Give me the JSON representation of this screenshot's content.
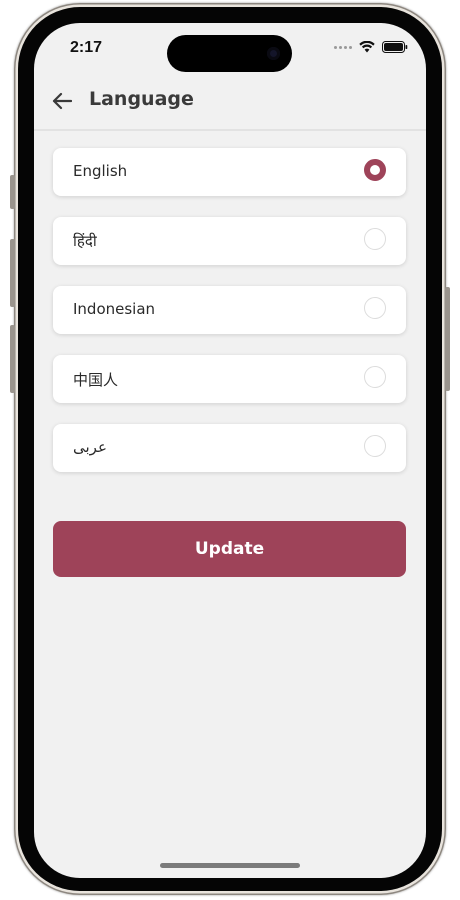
{
  "status_bar": {
    "time": "2:17",
    "icons": [
      "signal-dots-icon",
      "wifi-icon",
      "battery-icon"
    ]
  },
  "header": {
    "back_icon": "arrow-left-icon",
    "title": "Language"
  },
  "languages": {
    "items": [
      {
        "label": "English",
        "selected": true
      },
      {
        "label": "हिंदी",
        "selected": false
      },
      {
        "label": "Indonesian",
        "selected": false
      },
      {
        "label": "中国人",
        "selected": false
      },
      {
        "label": "عربى",
        "selected": false
      }
    ]
  },
  "actions": {
    "update_label": "Update"
  },
  "colors": {
    "accent": "#9e4359",
    "background": "#f1f1f1",
    "card": "#ffffff",
    "title_text": "#3a3a3a"
  }
}
